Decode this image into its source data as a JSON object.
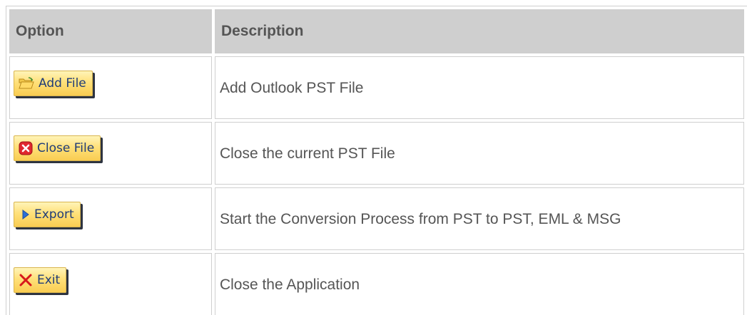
{
  "table": {
    "headers": {
      "option": "Option",
      "description": "Description"
    },
    "rows": [
      {
        "button_label": "Add File",
        "icon": "folder-open-icon",
        "description": "Add Outlook PST File"
      },
      {
        "button_label": "Close File",
        "icon": "close-red-icon",
        "description": "Close the current PST File"
      },
      {
        "button_label": "Export",
        "icon": "play-arrow-icon",
        "description": "Start the Conversion Process from PST to PST, EML & MSG"
      },
      {
        "button_label": "Exit",
        "icon": "x-mark-icon",
        "description": "Close the Application"
      }
    ]
  },
  "colors": {
    "header_bg": "#cfcfcf",
    "text": "#555555",
    "button_bg": "#ffe07a",
    "button_text": "#1f3c78",
    "close_red": "#e0282e",
    "export_blue": "#2a6fd6",
    "exit_red": "#d7171c"
  }
}
